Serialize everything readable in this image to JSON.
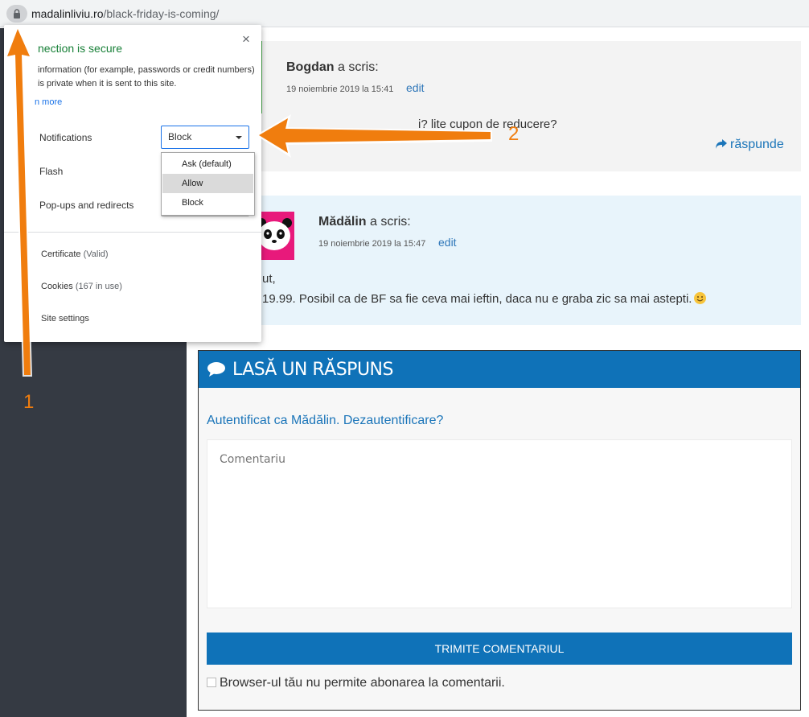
{
  "browser": {
    "url_domain": "madalinliviu.ro",
    "url_path": "/black-friday-is-coming/"
  },
  "popup": {
    "title": "nection is secure",
    "description": "information (for example, passwords or credit numbers) is private when it is sent to this site.",
    "learn_more": "n more",
    "close": "×",
    "permissions": [
      {
        "label": "Notifications",
        "value": "Block"
      },
      {
        "label": "Flash",
        "value": ""
      },
      {
        "label": "Pop-ups and redirects",
        "value": ""
      }
    ],
    "dropdown_options": [
      "Ask (default)",
      "Allow",
      "Block"
    ],
    "dropdown_highlighted": "Allow",
    "links": [
      {
        "label": "Certificate",
        "detail": "(Valid)"
      },
      {
        "label": "Cookies",
        "detail": "(167 in use)"
      },
      {
        "label": "Site settings",
        "detail": ""
      }
    ]
  },
  "comments": [
    {
      "author": "Bogdan",
      "verb": "a scris:",
      "date": "19 noiembrie 2019 la 15:41",
      "edit": "edit",
      "text": "i? lite cupon de reducere?",
      "reply": "răspunde"
    },
    {
      "author": "Mădălin",
      "verb": "a scris:",
      "date": "19 noiembrie 2019 la 15:47",
      "edit": "edit",
      "text_line1": "ut,",
      "text_line2": "19.99. Posibil ca de BF sa fie ceva mai ieftin, daca nu e graba zic sa mai astepti."
    }
  ],
  "reply_form": {
    "title": "LASĂ UN RĂSPUNS",
    "logged_in": "Autentificat ca Mădălin. Dezautentificare?",
    "textarea_placeholder": "Comentariu",
    "submit": "TRIMITE COMENTARIUL",
    "subscribe": "Browser-ul tău nu permite abonarea la comentarii."
  },
  "annotations": {
    "badge1": "1",
    "badge2": "2",
    "color": "#f07d0e"
  }
}
